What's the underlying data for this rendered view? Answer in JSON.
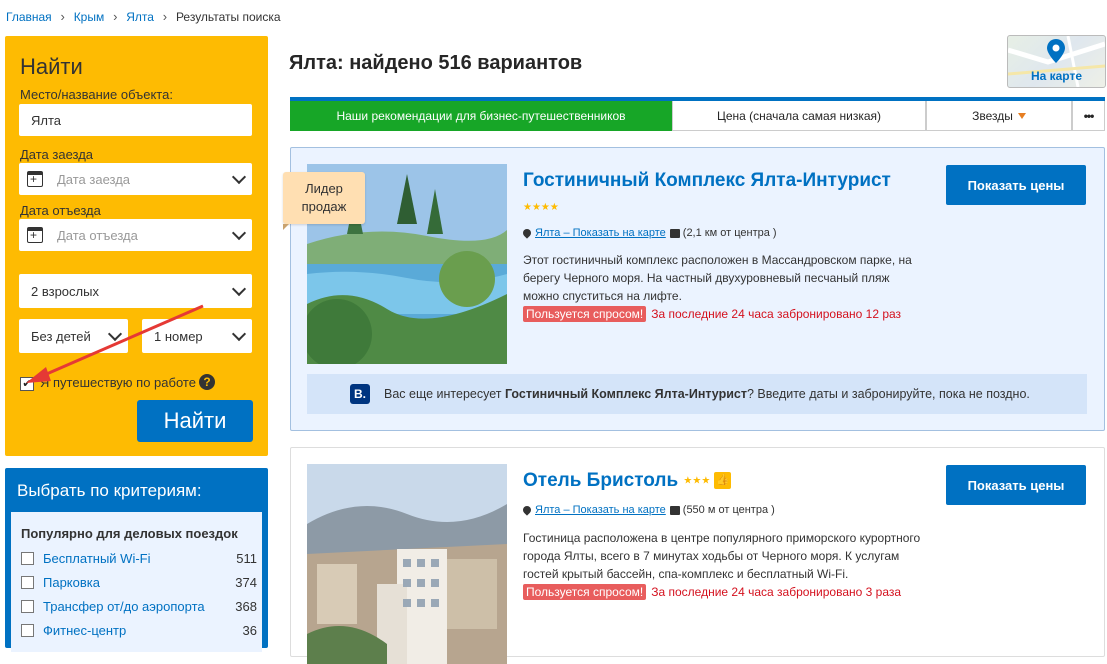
{
  "breadcrumb": {
    "items": [
      "Главная",
      "Крым",
      "Ялта"
    ],
    "current": "Результаты поиска"
  },
  "search": {
    "title": "Найти",
    "place_label": "Место/название объекта:",
    "place_value": "Ялта",
    "checkin_label": "Дата заезда",
    "checkin_placeholder": "Дата заезда",
    "checkout_label": "Дата отъезда",
    "checkout_placeholder": "Дата отъезда",
    "adults": "2 взрослых",
    "children": "Без детей",
    "rooms": "1 номер",
    "business_label": "Я путешествую по работе",
    "business_checked": "✔",
    "help_icon": "?",
    "submit": "Найти"
  },
  "criteria": {
    "title": "Выбрать по критериям:",
    "subtitle": "Популярно для деловых поездок",
    "filters": [
      {
        "label": "Бесплатный Wi-Fi",
        "count": "511"
      },
      {
        "label": "Парковка",
        "count": "374"
      },
      {
        "label": "Трансфер от/до аэропорта",
        "count": "368"
      },
      {
        "label": "Фитнес-центр",
        "count": "36"
      }
    ]
  },
  "results": {
    "heading": "Ялта: найдено 516 вариантов",
    "map_button": "На карте"
  },
  "sort": {
    "options": [
      "Наши рекомендации для бизнес-путешественников",
      "Цена (сначала самая низкая)",
      "Звезды",
      "•••"
    ],
    "active_color": "#17a627"
  },
  "hotels": [
    {
      "name": "Гостиничный Комплекс Ялта-Интурист",
      "stars": "★★★★",
      "location": "Ялта – Показать на карте",
      "distance": "(2,1 км от центра )",
      "description": "Этот гостиничный комплекс расположен в Массандровском парке, на берегу Черного моря. На частный двухуровневый песчаный пляж можно спуститься на лифте.",
      "demand_tag": "Пользуется спросом!",
      "demand_text": "За последние 24 часа забронировано 12 раз",
      "price_button": "Показать цены",
      "badge": "Лидер продаж",
      "promo_pre": "Вас еще интересует ",
      "promo_bold": "Гостиничный Комплекс Ялта-Интурист",
      "promo_post": "? Введите даты и забронируйте, пока не поздно.",
      "promo_logo": "B."
    },
    {
      "name": "Отель Бристоль",
      "stars": "★★★",
      "thumb_icon": "👍",
      "location": "Ялта – Показать на карте",
      "distance": "(550 м от центра )",
      "description": "Гостиница расположена в центре популярного приморского курортного города Ялты, всего в 7 минутах ходьбы от Черного моря. К услугам гостей крытый бассейн, спа-комплекс и бесплатный Wi-Fi.",
      "demand_tag": "Пользуется спросом!",
      "demand_text": "За последние 24 часа забронировано 3 раза",
      "price_button": "Показать цены"
    }
  ],
  "colors": {
    "brand_blue": "#0071c2",
    "panel_yellow": "#febb02",
    "annotation_arrow": "#e53935"
  }
}
